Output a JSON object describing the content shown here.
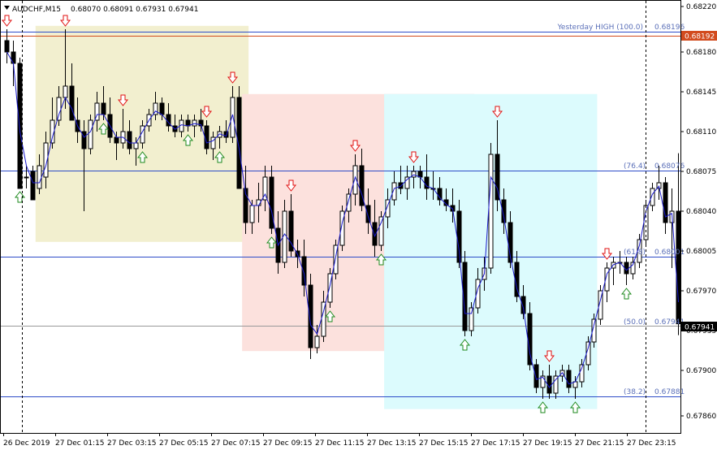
{
  "header": {
    "title": "AUDCHF,M15",
    "ohlc": "0.68070 0.68091 0.67931 0.67941"
  },
  "colors": {
    "background": "#ffffff",
    "bull_body": "#ffffff",
    "bear_body": "#000000",
    "line": "#1a1acc",
    "level_line": "#2d4cc8",
    "high_line": "#d24b1e",
    "zone_yellow": "#f2efcf",
    "zone_pink": "#fce1dd",
    "zone_gray": "#dcdfdc",
    "zone_cyan": "#dcfbfd",
    "arrow_down": "#e01010",
    "arrow_up": "#1e8a1e"
  },
  "levels": {
    "yesterday_high": {
      "label": "Yesterday HIGH (100.0)",
      "value": "0.68196"
    },
    "fib_76": {
      "label": "(76.4)",
      "value": "0.68076"
    },
    "fib_61": {
      "label": "(61.8)",
      "value": "0.68001"
    },
    "fib_50": {
      "label": "(50.0)",
      "value": "0.67941"
    },
    "fib_38": {
      "label": "(38.2)",
      "value": "0.67881"
    }
  },
  "price_tags": {
    "high_marker": "0.68192",
    "current": "0.67941"
  },
  "chart_data": {
    "type": "candlestick",
    "symbol": "AUDCHF",
    "timeframe": "M15",
    "ylim": [
      0.67845,
      0.68225
    ],
    "y_ticks": [
      "0.68220",
      "0.68180",
      "0.68145",
      "0.68110",
      "0.68075",
      "0.68040",
      "0.68005",
      "0.67970",
      "0.67935",
      "0.67900",
      "0.67860"
    ],
    "x_ticks": [
      "26 Dec 2019",
      "27 Dec 01:15",
      "27 Dec 03:15",
      "27 Dec 05:15",
      "27 Dec 07:15",
      "27 Dec 09:15",
      "27 Dec 11:15",
      "27 Dec 13:15",
      "27 Dec 15:15",
      "27 Dec 17:15",
      "27 Dec 19:15",
      "27 Dec 21:15",
      "27 Dec 23:15"
    ],
    "zones": [
      {
        "color": "yellow",
        "x0": 4.5,
        "x1": 37.5,
        "y0": 0.68013,
        "y1": 0.68203
      },
      {
        "color": "pink",
        "x0": 36.5,
        "x1": 72.5,
        "y0": 0.67917,
        "y1": 0.68143
      },
      {
        "color": "gray",
        "x0": 58.5,
        "x1": 72.5,
        "y0": 0.67917,
        "y1": 0.68143
      },
      {
        "color": "cyan",
        "x0": 58.5,
        "x1": 91.5,
        "y0": 0.67866,
        "y1": 0.68143
      }
    ],
    "candles": [
      [
        0.6819,
        0.682,
        0.6817,
        0.6818
      ],
      [
        0.6818,
        0.6819,
        0.6815,
        0.6817
      ],
      [
        0.6817,
        0.68175,
        0.6806,
        0.6806
      ],
      [
        0.6807,
        0.6808,
        0.6806,
        0.6807
      ],
      [
        0.68075,
        0.6808,
        0.6805,
        0.6805
      ],
      [
        0.6806,
        0.6809,
        0.68055,
        0.6808
      ],
      [
        0.6807,
        0.6811,
        0.6806,
        0.681
      ],
      [
        0.681,
        0.6814,
        0.68095,
        0.6812
      ],
      [
        0.6812,
        0.6815,
        0.68115,
        0.6814
      ],
      [
        0.6814,
        0.682,
        0.6813,
        0.6815
      ],
      [
        0.6815,
        0.6817,
        0.68125,
        0.6812
      ],
      [
        0.6812,
        0.6814,
        0.681,
        0.6811
      ],
      [
        0.6811,
        0.6812,
        0.6804,
        0.68095
      ],
      [
        0.68095,
        0.68125,
        0.6809,
        0.6812
      ],
      [
        0.6812,
        0.68145,
        0.6811,
        0.68135
      ],
      [
        0.68135,
        0.6815,
        0.6812,
        0.68125
      ],
      [
        0.68125,
        0.6814,
        0.681,
        0.68105
      ],
      [
        0.68105,
        0.6811,
        0.68085,
        0.681
      ],
      [
        0.681,
        0.6813,
        0.68095,
        0.6811
      ],
      [
        0.6811,
        0.6812,
        0.6809,
        0.68095
      ],
      [
        0.68095,
        0.68105,
        0.6808,
        0.681
      ],
      [
        0.681,
        0.6812,
        0.68095,
        0.68115
      ],
      [
        0.68115,
        0.6813,
        0.6811,
        0.68125
      ],
      [
        0.68125,
        0.68145,
        0.6812,
        0.68135
      ],
      [
        0.68135,
        0.6814,
        0.6812,
        0.68125
      ],
      [
        0.68125,
        0.68135,
        0.6811,
        0.68115
      ],
      [
        0.68115,
        0.68125,
        0.68105,
        0.6811
      ],
      [
        0.6811,
        0.68125,
        0.68105,
        0.6812
      ],
      [
        0.6812,
        0.68125,
        0.6811,
        0.68115
      ],
      [
        0.68115,
        0.68125,
        0.68105,
        0.6812
      ],
      [
        0.6812,
        0.6813,
        0.6811,
        0.68115
      ],
      [
        0.68115,
        0.6812,
        0.6809,
        0.68095
      ],
      [
        0.68095,
        0.6811,
        0.68085,
        0.68105
      ],
      [
        0.68105,
        0.68115,
        0.68095,
        0.6811
      ],
      [
        0.6811,
        0.6812,
        0.681,
        0.68105
      ],
      [
        0.68105,
        0.6815,
        0.681,
        0.6814
      ],
      [
        0.6814,
        0.6815,
        0.6806,
        0.6806
      ],
      [
        0.6806,
        0.6808,
        0.6802,
        0.6803
      ],
      [
        0.6803,
        0.6805,
        0.6802,
        0.68045
      ],
      [
        0.68045,
        0.68065,
        0.6803,
        0.6805
      ],
      [
        0.6805,
        0.6808,
        0.6804,
        0.6807
      ],
      [
        0.6807,
        0.6808,
        0.6802,
        0.68025
      ],
      [
        0.68025,
        0.6804,
        0.67985,
        0.67995
      ],
      [
        0.67995,
        0.6805,
        0.6799,
        0.6804
      ],
      [
        0.6804,
        0.68055,
        0.68,
        0.68005
      ],
      [
        0.68005,
        0.68015,
        0.6799,
        0.68
      ],
      [
        0.68,
        0.68015,
        0.67965,
        0.67975
      ],
      [
        0.67975,
        0.67985,
        0.6791,
        0.6792
      ],
      [
        0.6792,
        0.6794,
        0.67915,
        0.6793
      ],
      [
        0.6793,
        0.6797,
        0.67925,
        0.6796
      ],
      [
        0.6796,
        0.6799,
        0.67955,
        0.67985
      ],
      [
        0.67985,
        0.68015,
        0.6798,
        0.6801
      ],
      [
        0.6801,
        0.68045,
        0.68005,
        0.6804
      ],
      [
        0.6804,
        0.6806,
        0.6803,
        0.68055
      ],
      [
        0.68055,
        0.6809,
        0.68045,
        0.6808
      ],
      [
        0.6808,
        0.68095,
        0.6804,
        0.68045
      ],
      [
        0.68045,
        0.6806,
        0.6802,
        0.6803
      ],
      [
        0.6803,
        0.6805,
        0.68,
        0.6801
      ],
      [
        0.6801,
        0.6804,
        0.68005,
        0.68035
      ],
      [
        0.68035,
        0.6806,
        0.68025,
        0.6805
      ],
      [
        0.6805,
        0.68075,
        0.68045,
        0.68065
      ],
      [
        0.68065,
        0.6808,
        0.68055,
        0.6806
      ],
      [
        0.6806,
        0.6808,
        0.6805,
        0.6807
      ],
      [
        0.6807,
        0.6808,
        0.6806,
        0.68075
      ],
      [
        0.68075,
        0.6808,
        0.6806,
        0.6807
      ],
      [
        0.6807,
        0.6809,
        0.6805,
        0.6806
      ],
      [
        0.6806,
        0.68075,
        0.6805,
        0.6806
      ],
      [
        0.6806,
        0.6807,
        0.68045,
        0.6805
      ],
      [
        0.6805,
        0.6806,
        0.6804,
        0.68045
      ],
      [
        0.68045,
        0.6806,
        0.6803,
        0.6804
      ],
      [
        0.6804,
        0.6805,
        0.6799,
        0.67995
      ],
      [
        0.67995,
        0.68005,
        0.6793,
        0.67935
      ],
      [
        0.67935,
        0.6796,
        0.6793,
        0.67955
      ],
      [
        0.67955,
        0.6799,
        0.6795,
        0.6798
      ],
      [
        0.6798,
        0.68,
        0.6797,
        0.6799
      ],
      [
        0.6799,
        0.681,
        0.67985,
        0.6809
      ],
      [
        0.6809,
        0.6812,
        0.6804,
        0.6805
      ],
      [
        0.6805,
        0.6806,
        0.6802,
        0.6803
      ],
      [
        0.6803,
        0.6804,
        0.6799,
        0.67995
      ],
      [
        0.67995,
        0.68005,
        0.6796,
        0.67965
      ],
      [
        0.67965,
        0.67975,
        0.67945,
        0.6795
      ],
      [
        0.6795,
        0.6796,
        0.679,
        0.67905
      ],
      [
        0.67905,
        0.6791,
        0.6788,
        0.67885
      ],
      [
        0.67885,
        0.679,
        0.67875,
        0.67895
      ],
      [
        0.67895,
        0.67905,
        0.67875,
        0.6788
      ],
      [
        0.6788,
        0.679,
        0.67875,
        0.67895
      ],
      [
        0.67895,
        0.67905,
        0.6789,
        0.679
      ],
      [
        0.679,
        0.67905,
        0.6788,
        0.67885
      ],
      [
        0.67885,
        0.67895,
        0.67875,
        0.6789
      ],
      [
        0.6789,
        0.6791,
        0.67885,
        0.67905
      ],
      [
        0.67905,
        0.6793,
        0.679,
        0.67925
      ],
      [
        0.67925,
        0.6795,
        0.6792,
        0.67945
      ],
      [
        0.67945,
        0.67975,
        0.6794,
        0.6797
      ],
      [
        0.6797,
        0.67995,
        0.6796,
        0.6799
      ],
      [
        0.6799,
        0.68,
        0.67975,
        0.67995
      ],
      [
        0.67995,
        0.68005,
        0.67985,
        0.67995
      ],
      [
        0.67995,
        0.68,
        0.67975,
        0.67985
      ],
      [
        0.67985,
        0.68,
        0.6798,
        0.67995
      ],
      [
        0.67995,
        0.6802,
        0.6799,
        0.68015
      ],
      [
        0.68015,
        0.6805,
        0.6801,
        0.68045
      ],
      [
        0.68045,
        0.68065,
        0.6804,
        0.6806
      ],
      [
        0.6806,
        0.6808,
        0.6805,
        0.68065
      ],
      [
        0.68065,
        0.6807,
        0.6802,
        0.6803
      ],
      [
        0.6803,
        0.6806,
        0.6799,
        0.6804
      ],
      [
        0.6804,
        0.68091,
        0.67931,
        0.67941
      ]
    ],
    "ma_line": [
      0.6818,
      0.6817,
      0.6811,
      0.6808,
      0.68065,
      0.68065,
      0.6808,
      0.68105,
      0.68125,
      0.6814,
      0.6813,
      0.68115,
      0.68105,
      0.6811,
      0.68125,
      0.68125,
      0.68115,
      0.68105,
      0.68105,
      0.681,
      0.681,
      0.6811,
      0.6812,
      0.68128,
      0.68125,
      0.68118,
      0.68112,
      0.68116,
      0.68115,
      0.68117,
      0.68116,
      0.681,
      0.68102,
      0.68108,
      0.68106,
      0.68125,
      0.68095,
      0.68055,
      0.68045,
      0.68045,
      0.68055,
      0.6804,
      0.6801,
      0.6802,
      0.68012,
      0.68002,
      0.67985,
      0.6794,
      0.67932,
      0.67952,
      0.67975,
      0.68,
      0.6803,
      0.6805,
      0.6807,
      0.68055,
      0.68035,
      0.68018,
      0.6803,
      0.68045,
      0.6806,
      0.68062,
      0.68068,
      0.68072,
      0.6807,
      0.68062,
      0.6806,
      0.68052,
      0.68046,
      0.68042,
      0.68005,
      0.6795,
      0.6795,
      0.67972,
      0.67985,
      0.6807,
      0.6806,
      0.68035,
      0.68,
      0.67972,
      0.67955,
      0.67915,
      0.67892,
      0.67894,
      0.67885,
      0.67892,
      0.67898,
      0.67888,
      0.6789,
      0.67902,
      0.6792,
      0.6794,
      0.67962,
      0.67985,
      0.67993,
      0.67995,
      0.67988,
      0.67993,
      0.6801,
      0.6804,
      0.68055,
      0.68062,
      0.68035,
      0.68038,
      0.6796
    ],
    "signals": [
      {
        "i": 0,
        "dir": "down"
      },
      {
        "i": 9,
        "dir": "down"
      },
      {
        "i": 18,
        "dir": "down"
      },
      {
        "i": 31,
        "dir": "down"
      },
      {
        "i": 35,
        "dir": "down"
      },
      {
        "i": 2,
        "dir": "up"
      },
      {
        "i": 15,
        "dir": "up"
      },
      {
        "i": 21,
        "dir": "up"
      },
      {
        "i": 28,
        "dir": "up"
      },
      {
        "i": 33,
        "dir": "up"
      },
      {
        "i": 44,
        "dir": "down"
      },
      {
        "i": 54,
        "dir": "down"
      },
      {
        "i": 63,
        "dir": "down"
      },
      {
        "i": 76,
        "dir": "down"
      },
      {
        "i": 41,
        "dir": "up"
      },
      {
        "i": 50,
        "dir": "up"
      },
      {
        "i": 58,
        "dir": "up"
      },
      {
        "i": 71,
        "dir": "up"
      },
      {
        "i": 84,
        "dir": "down"
      },
      {
        "i": 93,
        "dir": "down"
      },
      {
        "i": 83,
        "dir": "up"
      },
      {
        "i": 88,
        "dir": "up"
      },
      {
        "i": 96,
        "dir": "up"
      }
    ]
  }
}
